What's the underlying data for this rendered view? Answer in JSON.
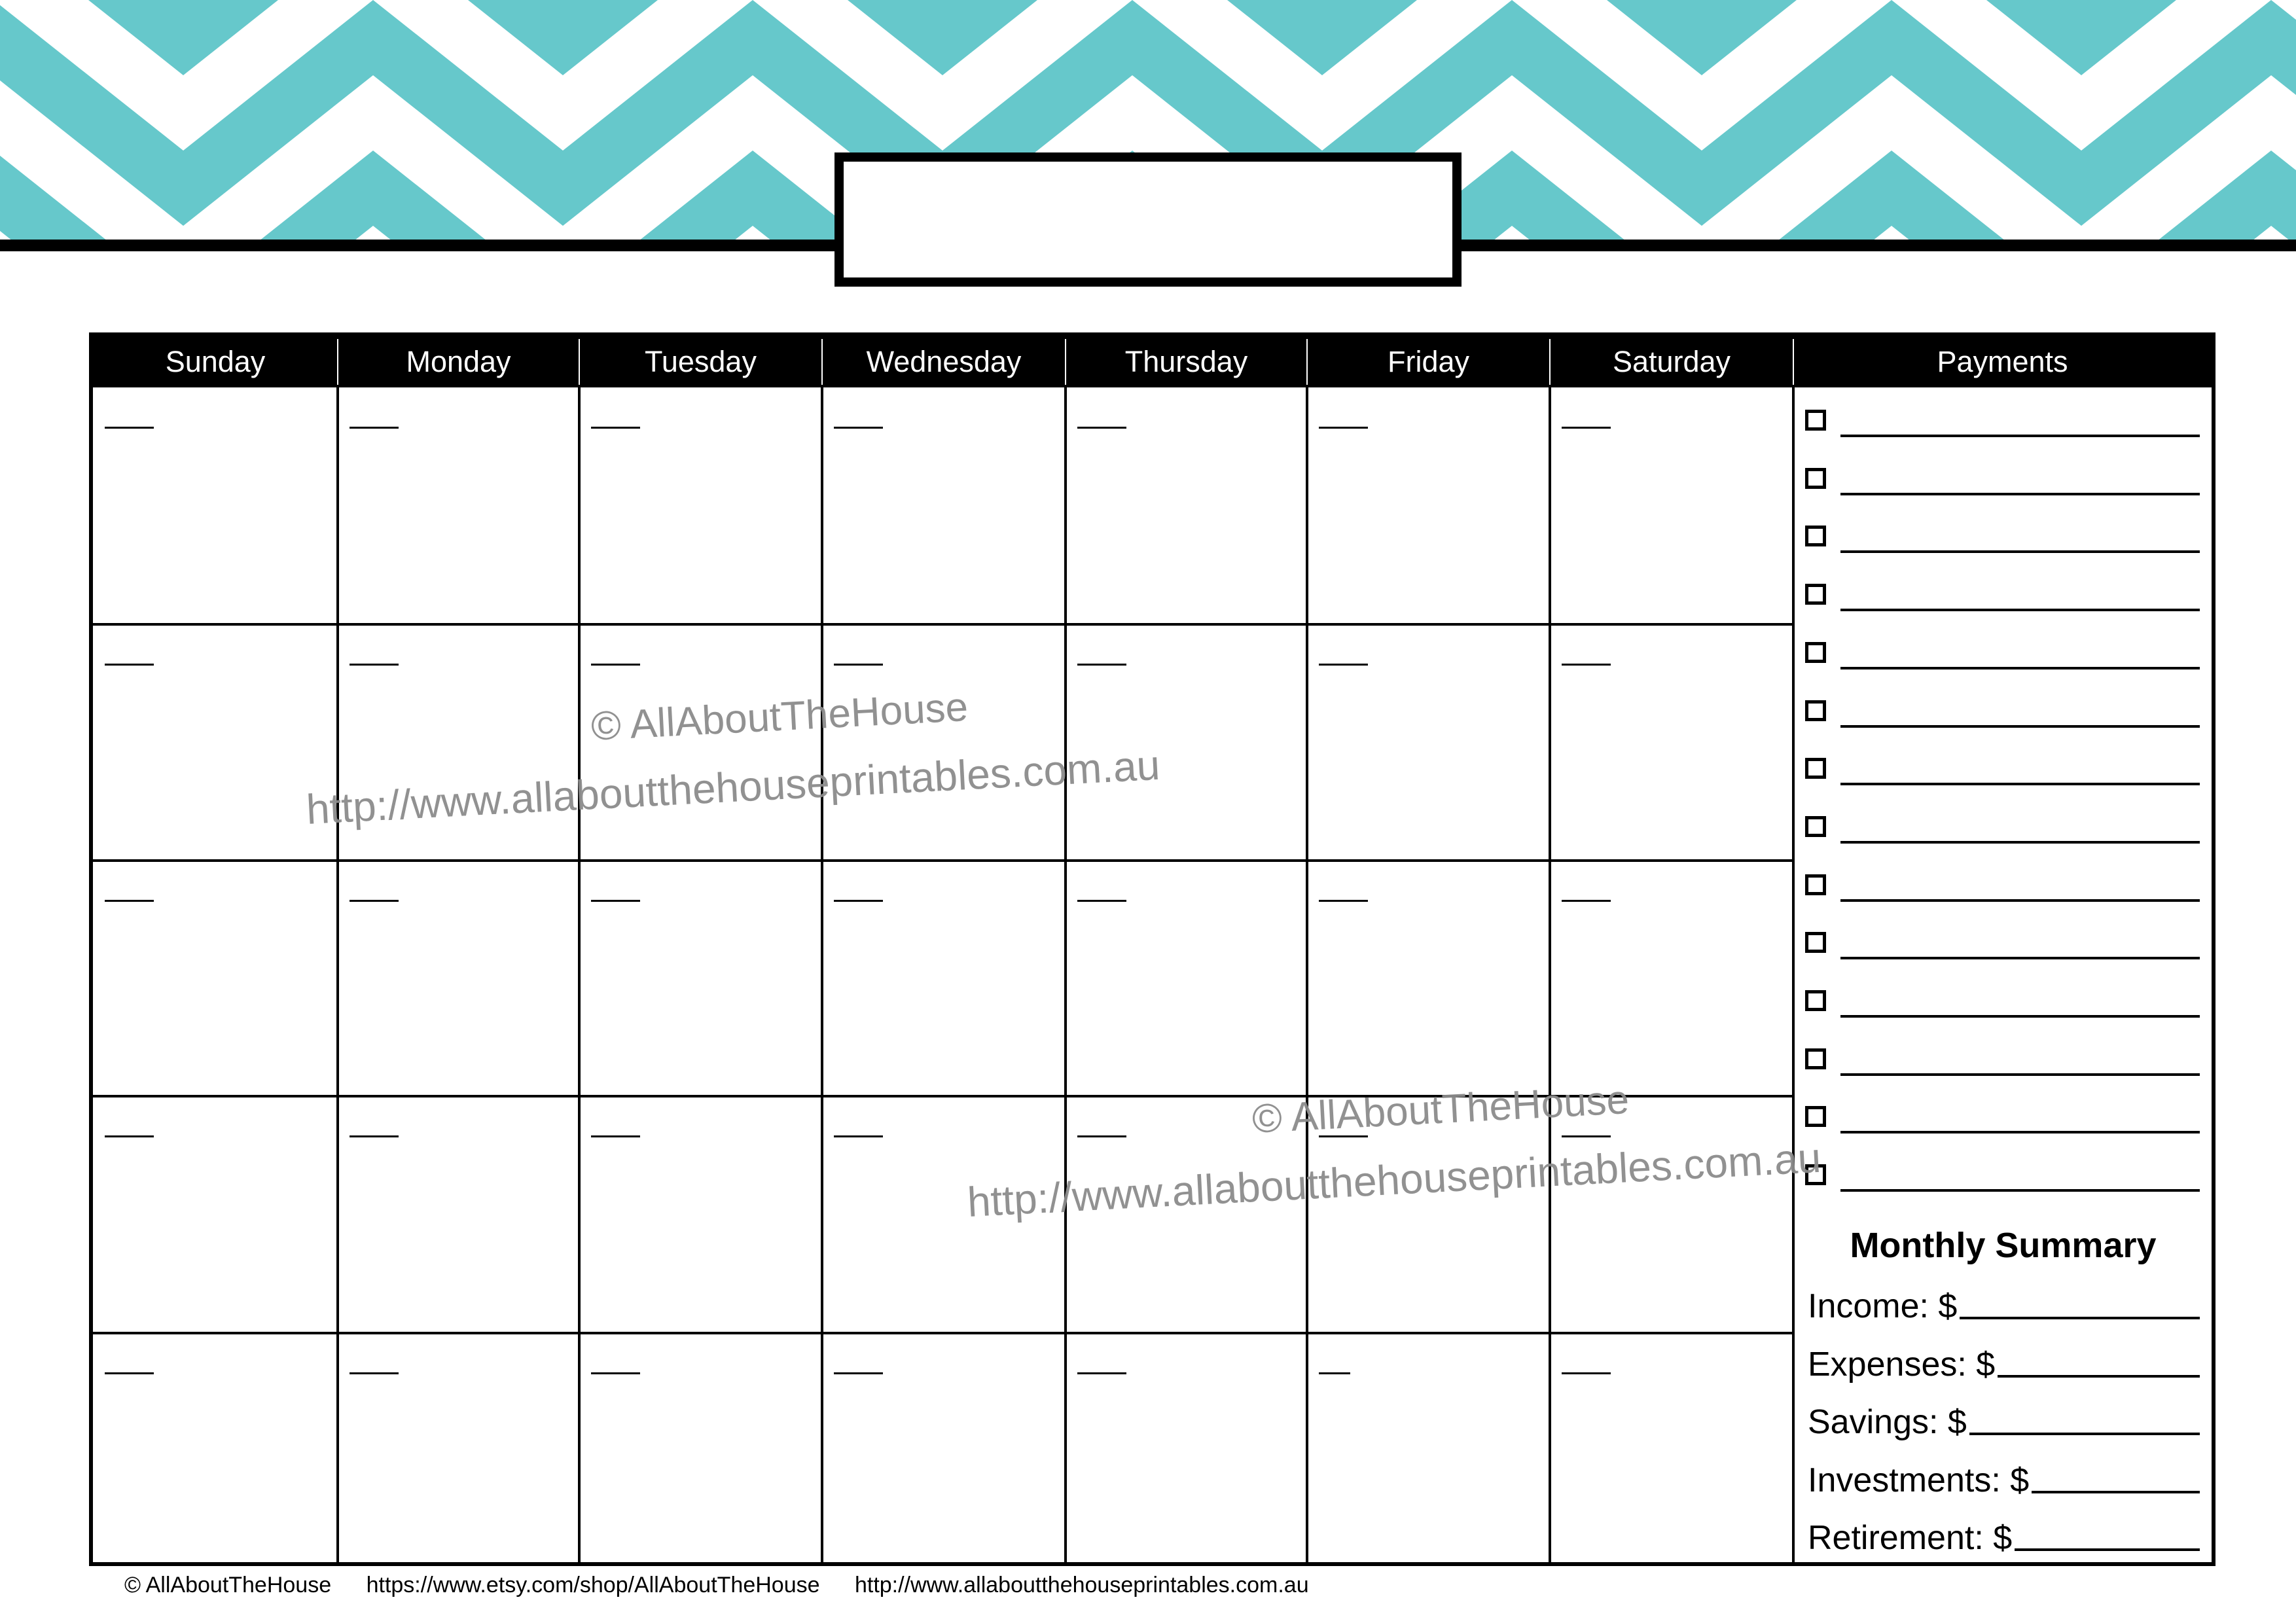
{
  "colors": {
    "accent": "#66c8cb",
    "ink": "#000000",
    "watermark": "#8c8c8c"
  },
  "title_box": {
    "text": ""
  },
  "calendar": {
    "days": [
      "Sunday",
      "Monday",
      "Tuesday",
      "Wednesday",
      "Thursday",
      "Friday",
      "Saturday"
    ],
    "weeks": 5,
    "day_number_placeholder": "___"
  },
  "payments": {
    "header": "Payments",
    "item_count": 14
  },
  "monthly_summary": {
    "title": "Monthly Summary",
    "rows": [
      {
        "label": "Income: $"
      },
      {
        "label": "Expenses: $"
      },
      {
        "label": "Savings: $"
      },
      {
        "label": "Investments: $"
      },
      {
        "label": "Retirement: $"
      }
    ]
  },
  "watermarks": [
    {
      "line1": "© AllAboutTheHouse",
      "line2": "http://www.allaboutthehouseprintables.com.au"
    },
    {
      "line1": "© AllAboutTheHouse",
      "line2": "http://www.allaboutthehouseprintables.com.au"
    }
  ],
  "footer": {
    "copyright": "© AllAboutTheHouse",
    "etsy": "https://www.etsy.com/shop/AllAboutTheHouse",
    "website": "http://www.allaboutthehouseprintables.com.au"
  }
}
